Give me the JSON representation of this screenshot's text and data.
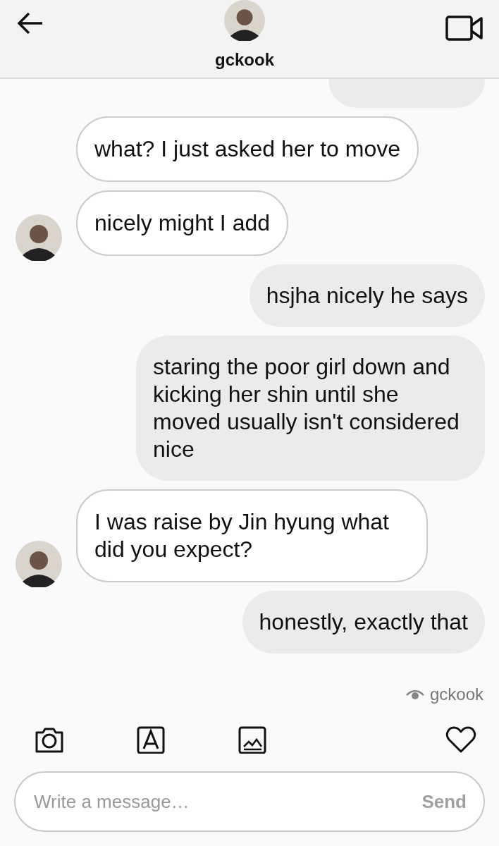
{
  "header": {
    "username": "gckook"
  },
  "messages": [
    {
      "sent": true,
      "kind": "clipped",
      "avatar": false
    },
    {
      "sent": false,
      "kind": "text",
      "text": "what? I just asked her to move",
      "avatar": false
    },
    {
      "sent": false,
      "kind": "text",
      "text": "nicely might I add",
      "avatar": true
    },
    {
      "sent": true,
      "kind": "text",
      "text": "hsjha nicely he says",
      "avatar": false
    },
    {
      "sent": true,
      "kind": "text",
      "text": "staring the poor girl down and kicking her shin until she moved usually isn't considered nice",
      "avatar": false
    },
    {
      "sent": false,
      "kind": "text",
      "text": "I was raise by Jin hyung what did you expect?",
      "avatar": true
    },
    {
      "sent": true,
      "kind": "text",
      "text": "honestly, exactly that",
      "avatar": false
    }
  ],
  "seen_by": "gckook",
  "composer": {
    "placeholder": "Write a message…",
    "send": "Send"
  }
}
